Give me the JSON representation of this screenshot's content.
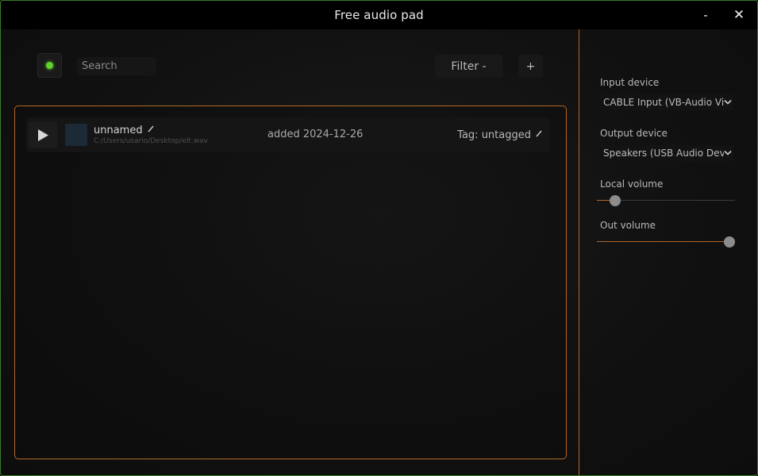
{
  "window": {
    "title": "Free audio pad",
    "minimize_label": "-",
    "close_label": "✕"
  },
  "toolbar": {
    "search_placeholder": "Search",
    "filter_label": "Filter -",
    "add_label": "+",
    "status_color": "#5ed12a"
  },
  "sounds": [
    {
      "name": "unnamed",
      "path": "C:/Users/usario/Desktop/elt.wav",
      "added": "added 2024-12-26",
      "tag": "Tag: untagged"
    }
  ],
  "settings": {
    "input_device_label": "Input device",
    "input_device_value": "CABLE Input (VB-Audio Virtual Cable)",
    "output_device_label": "Output device",
    "output_device_value": "Speakers (USB Audio Device)",
    "local_volume_label": "Local volume",
    "local_volume": 0.1,
    "out_volume_label": "Out volume",
    "out_volume": 1.0
  },
  "colors": {
    "accent": "#b2682a",
    "window_border": "#3a7a2a",
    "status_green": "#5ed12a"
  }
}
